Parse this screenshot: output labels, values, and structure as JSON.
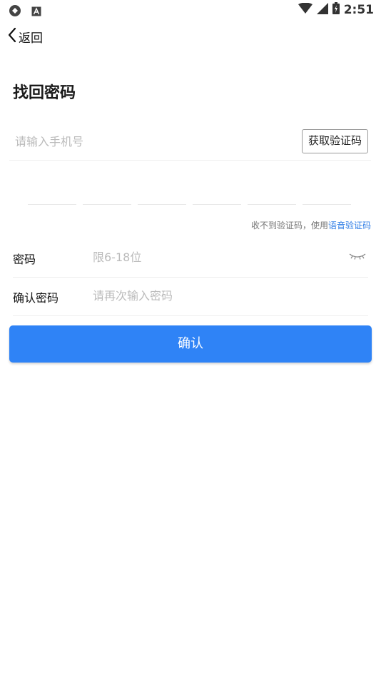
{
  "status_bar": {
    "time": "2:51",
    "icons": [
      "sync-icon",
      "notification-a-icon",
      "wifi-icon",
      "signal-icon",
      "battery-icon"
    ]
  },
  "nav": {
    "back_label": "返回"
  },
  "title": "找回密码",
  "phone": {
    "placeholder": "请输入手机号",
    "get_code_label": "获取验证码"
  },
  "code_boxes": 6,
  "voice_tip": {
    "prefix": "收不到验证码，使用",
    "link": "语音验证码"
  },
  "password": {
    "label": "密码",
    "placeholder": "限6-18位"
  },
  "confirm_password": {
    "label": "确认密码",
    "placeholder": "请再次输入密码"
  },
  "submit_label": "确认",
  "colors": {
    "primary": "#2f83f6",
    "link": "#2f7de6",
    "placeholder": "#bbbbbb",
    "divider": "#eeeeee"
  }
}
